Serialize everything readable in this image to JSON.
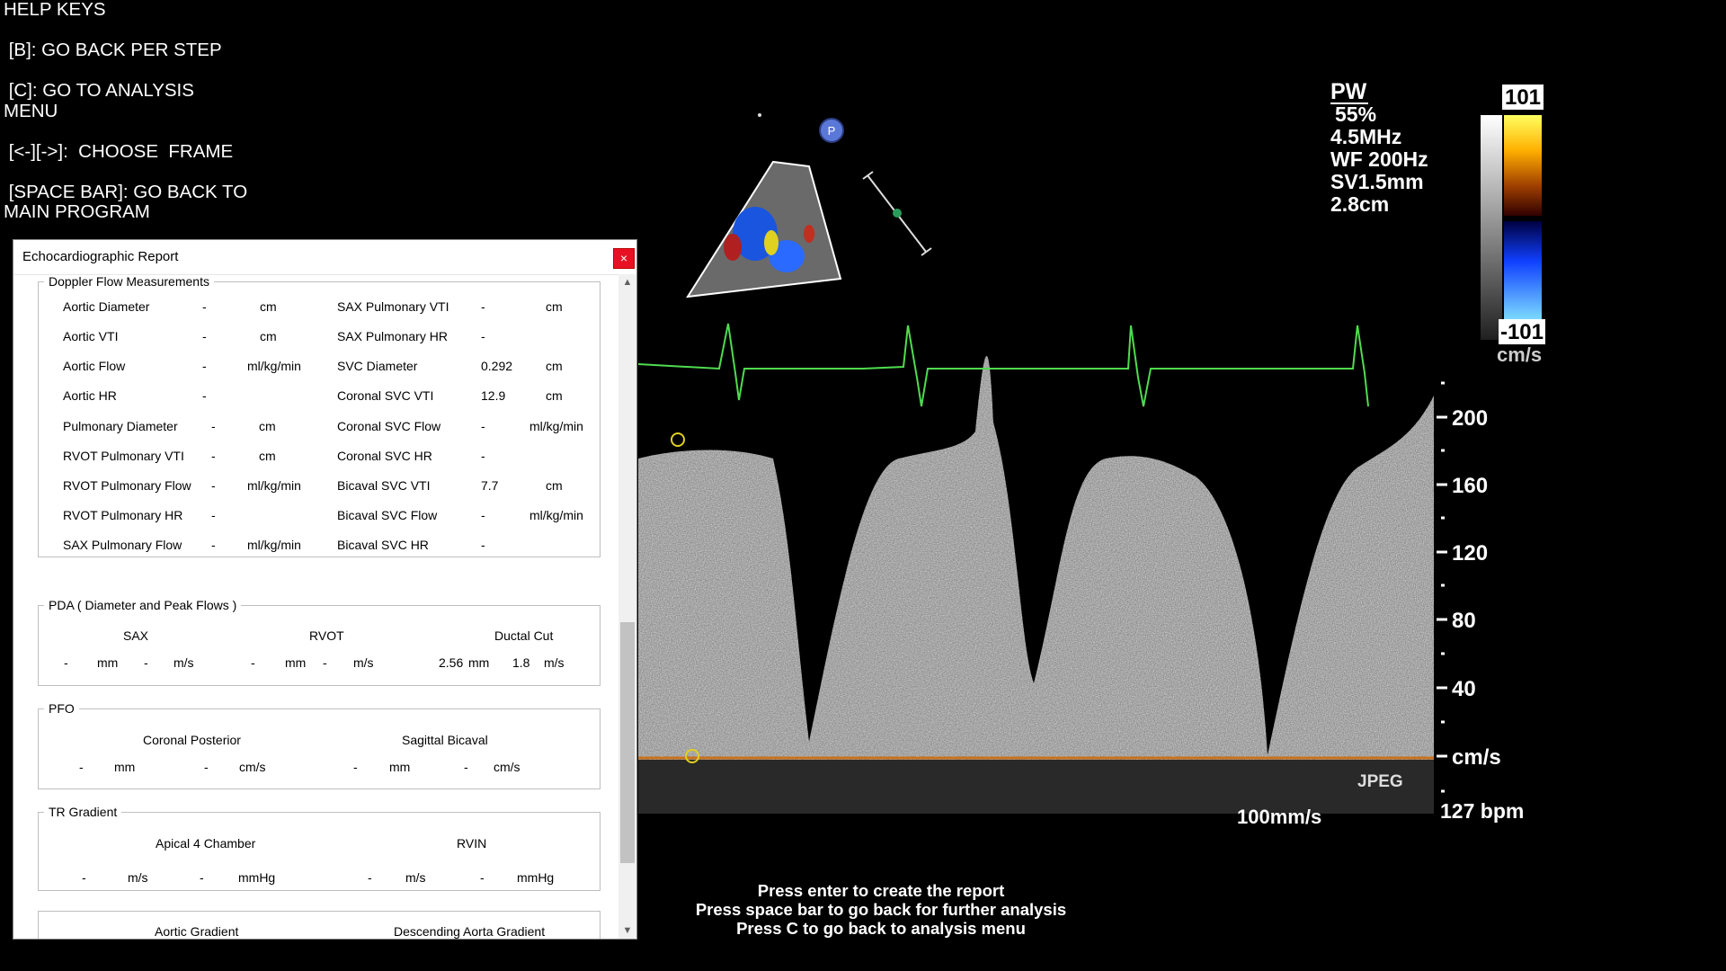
{
  "help": {
    "title": "HELP KEYS",
    "b_key": " [B]: GO BACK PER STEP",
    "c_key": " [C]: GO TO ANALYSIS\nMENU",
    "arrows_key": " [<-][->]:  CHOOSE  FRAME",
    "space_key": " [SPACE BAR]: GO BACK TO\nMAIN PROGRAM"
  },
  "report": {
    "window_title": "Echocardiographic Report",
    "close_label": "×",
    "doppler": {
      "legend": "Doppler Flow Measurements",
      "left": [
        {
          "label": "Aortic Diameter",
          "value": "-",
          "unit": "cm"
        },
        {
          "label": "Aortic VTI",
          "value": "-",
          "unit": "cm"
        },
        {
          "label": "Aortic Flow",
          "value": "-",
          "unit": "ml/kg/min"
        },
        {
          "label": "Aortic HR",
          "value": "-",
          "unit": ""
        },
        {
          "label": "Pulmonary Diameter",
          "value": "-",
          "unit": "cm"
        },
        {
          "label": "RVOT Pulmonary VTI",
          "value": "-",
          "unit": "cm"
        },
        {
          "label": "RVOT Pulmonary Flow",
          "value": "-",
          "unit": "ml/kg/min"
        },
        {
          "label": "RVOT Pulmonary HR",
          "value": "-",
          "unit": ""
        },
        {
          "label": "SAX Pulmonary Flow",
          "value": "-",
          "unit": "ml/kg/min"
        }
      ],
      "right": [
        {
          "label": "SAX Pulmonary VTI",
          "value": "-",
          "unit": "cm"
        },
        {
          "label": "SAX Pulmonary HR",
          "value": "-",
          "unit": ""
        },
        {
          "label": "SVC Diameter",
          "value": "0.292",
          "unit": "cm"
        },
        {
          "label": "Coronal SVC VTI",
          "value": "12.9",
          "unit": "cm"
        },
        {
          "label": "Coronal SVC Flow",
          "value": "-",
          "unit": "ml/kg/min"
        },
        {
          "label": "Coronal SVC HR",
          "value": "-",
          "unit": ""
        },
        {
          "label": "Bicaval SVC VTI",
          "value": "7.7",
          "unit": "cm"
        },
        {
          "label": "Bicaval SVC Flow",
          "value": "-",
          "unit": "ml/kg/min"
        },
        {
          "label": "Bicaval SVC HR",
          "value": "-",
          "unit": ""
        }
      ]
    },
    "pda": {
      "legend": "PDA ( Diameter and Peak Flows )",
      "sax": "SAX",
      "rvot": "RVOT",
      "ductal": "Ductal Cut",
      "row": [
        "-",
        "mm",
        "-",
        "m/s",
        "-",
        "mm",
        "-",
        "m/s",
        "2.56",
        "mm",
        "1.8",
        "m/s"
      ]
    },
    "pfo": {
      "legend": "PFO",
      "coronal": "Coronal Posterior",
      "sagittal": "Sagittal Bicaval",
      "row": [
        "-",
        "mm",
        "-",
        "cm/s",
        "-",
        "mm",
        "-",
        "cm/s"
      ]
    },
    "tr": {
      "legend": "TR Gradient",
      "apical": "Apical 4 Chamber",
      "rvin": "RVIN",
      "row": [
        "-",
        "m/s",
        "-",
        "mmHg",
        "-",
        "m/s",
        "-",
        "mmHg"
      ]
    },
    "gradients": {
      "aortic": "Aortic Gradient",
      "descending": "Descending Aorta Gradient"
    }
  },
  "ultrasound": {
    "mode": "PW",
    "params": [
      "55%",
      "4.5MHz",
      "WF 200Hz",
      "SV1.5mm",
      "2.8cm"
    ],
    "scale_top": "101",
    "scale_bottom": "-101",
    "scale_unit": "cm/s",
    "axis_ticks": [
      "200",
      "160",
      "120",
      "80",
      "40"
    ],
    "axis_unit": "cm/s",
    "probe_marker": "P",
    "format_label": "JPEG",
    "sweep_speed": "100mm/s",
    "heart_rate": "127 bpm"
  },
  "instructions": [
    "Press enter to create the report",
    "Press space bar to go back for further analysis",
    "Press C to go back to analysis menu"
  ]
}
